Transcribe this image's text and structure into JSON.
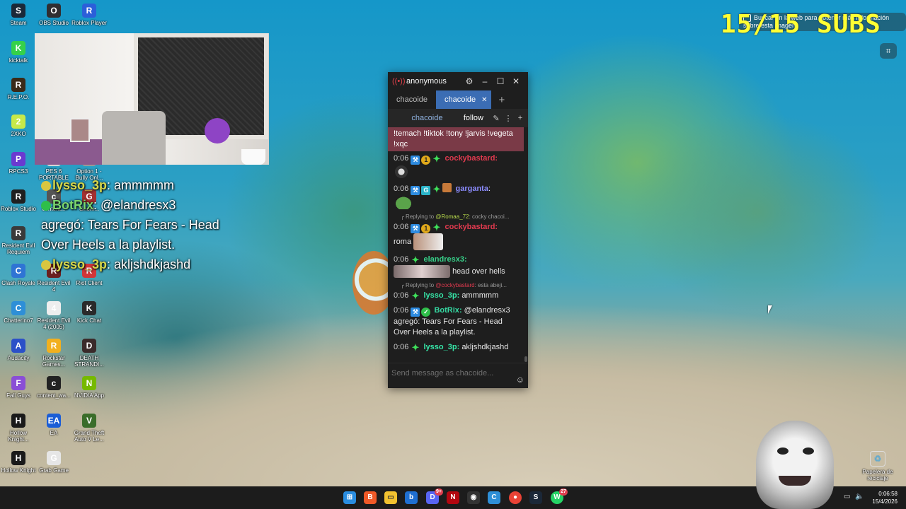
{
  "desktop_icons": [
    {
      "label": "Steam",
      "color": "#1b2838",
      "glyph": "S"
    },
    {
      "label": "OBS Studio",
      "color": "#302e31",
      "glyph": "O"
    },
    {
      "label": "Roblox Player",
      "color": "#2b5fd9",
      "glyph": "R"
    },
    {
      "label": "kicktalk",
      "color": "#35d14a",
      "glyph": "K"
    },
    {
      "label": "R.E.P.O.",
      "color": "#3a2a18",
      "glyph": "R"
    },
    {
      "label": "2XKO",
      "color": "#c7e94a",
      "glyph": "2"
    },
    {
      "label": "RPCS3",
      "color": "#6a3ad0",
      "glyph": "P"
    },
    {
      "label": "PES 6 PORTABLE",
      "color": "#d6d6d6",
      "glyph": "P"
    },
    {
      "label": "Option 1 - Bully Onl...",
      "color": "#999999",
      "glyph": "B"
    },
    {
      "label": "Roblox Studio",
      "color": "#1f1f1f",
      "glyph": "R"
    },
    {
      "label": "content...",
      "color": "#555555",
      "glyph": "c"
    },
    {
      "label": "Gnom...",
      "color": "#a23030",
      "glyph": "G"
    },
    {
      "label": "Resident Evil Requiem",
      "color": "#3a3a3a",
      "glyph": "R"
    },
    {
      "label": "Clash Royale",
      "color": "#2f74d4",
      "glyph": "C"
    },
    {
      "label": "Resident Evil 4",
      "color": "#6a1f1f",
      "glyph": "R"
    },
    {
      "label": "Riot Client",
      "color": "#d13639",
      "glyph": "R"
    },
    {
      "label": "Chatterino7",
      "color": "#2e8fd7",
      "glyph": "C"
    },
    {
      "label": "Resident Evil 4 (2005)",
      "color": "#eeeeee",
      "glyph": "4"
    },
    {
      "label": "Kick Chat",
      "color": "#2a2a2a",
      "glyph": "K"
    },
    {
      "label": "Audacity",
      "color": "#2b50c8",
      "glyph": "A"
    },
    {
      "label": "Rockstar Games...",
      "color": "#f2b01e",
      "glyph": "R"
    },
    {
      "label": "DEATH STRANDI...",
      "color": "#3a2a2a",
      "glyph": "D"
    },
    {
      "label": "Fall Guys",
      "color": "#8a4ed6",
      "glyph": "F"
    },
    {
      "label": "content_wa...",
      "color": "#222222",
      "glyph": "c"
    },
    {
      "label": "NVIDIA App",
      "color": "#76b900",
      "glyph": "N"
    },
    {
      "label": "Hollow Knight...",
      "color": "#1a1a1a",
      "glyph": "H"
    },
    {
      "label": "EA",
      "color": "#1b5ed6",
      "glyph": "EA"
    },
    {
      "label": "Grand Theft Auto V Le...",
      "color": "#3a6d2a",
      "glyph": "V"
    },
    {
      "label": "Hollow Knight",
      "color": "#1a1a1a",
      "glyph": "H"
    },
    {
      "label": "Grab Game",
      "color": "#e6e6e6",
      "glyph": "G"
    }
  ],
  "recycle_bin": {
    "label": "Papelera de reciclaje",
    "icon": "recycle-bin-icon"
  },
  "overlay_chat": [
    {
      "user": "lysso_3p",
      "text": ": ammmmm"
    },
    {
      "user": "BotRix",
      "text": ": @elandresx3"
    },
    {
      "text": "agregó: Tears For Fears - Head Over Heels a la playlist."
    },
    {
      "user": "lysso_3p",
      "text": ": akljshdkjashd"
    }
  ],
  "subs_counter": "15/15 SUBS",
  "lens_tip": "Buscar en la web para obtener más información sobre esta imagen",
  "chat_window": {
    "title": "anonymous",
    "tabs": [
      "chacoide",
      "chacoide"
    ],
    "active_tab": 1,
    "channel": "chacoide",
    "follow_label": "follow",
    "pinned": "!temach !tiktok !tony !jarvis !vegeta !xqc",
    "messages": [
      {
        "time": "0:06",
        "user": "cockybastard",
        "text": ""
      },
      {
        "time": "0:06",
        "user": "garganta",
        "text": ""
      },
      {
        "reply_to": "@Romaa_72",
        "reply_text": ": cocky chacoi...",
        "time": "0:06",
        "user": "cockybastard",
        "text": "roma"
      },
      {
        "time": "0:06",
        "user": "elandresx3",
        "text": "head over hells"
      },
      {
        "reply_to": "@cockybastard",
        "reply_text": ": esta abeji...",
        "time": "0:06",
        "user": "lysso_3p",
        "text": "ammmmm"
      },
      {
        "time": "0:06",
        "user": "BotRix",
        "text": "@elandresx3 agregó: Tears For Fears - Head Over Heels a la playlist."
      },
      {
        "time": "0:06",
        "user": "lysso_3p",
        "text": "akljshdkjashd"
      }
    ],
    "input_placeholder": "Send message as chacoide..."
  },
  "taskbar": {
    "time": "0:06:58",
    "date": "15/4/2026",
    "badges": {
      "discord": "9+",
      "whatsapp": "27"
    }
  }
}
